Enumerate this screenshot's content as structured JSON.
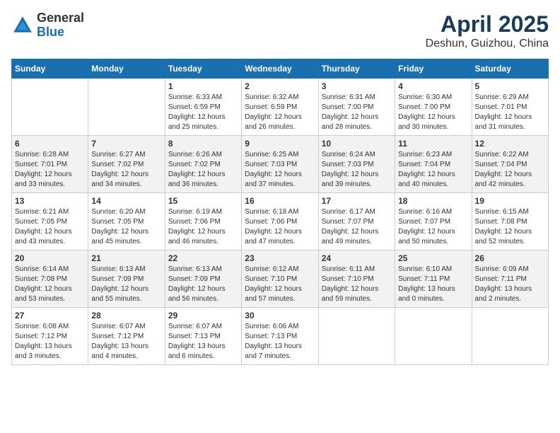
{
  "header": {
    "logo_general": "General",
    "logo_blue": "Blue",
    "month_title": "April 2025",
    "location": "Deshun, Guizhou, China"
  },
  "calendar": {
    "days_of_week": [
      "Sunday",
      "Monday",
      "Tuesday",
      "Wednesday",
      "Thursday",
      "Friday",
      "Saturday"
    ],
    "weeks": [
      [
        {
          "day": "",
          "info": ""
        },
        {
          "day": "",
          "info": ""
        },
        {
          "day": "1",
          "info": "Sunrise: 6:33 AM\nSunset: 6:59 PM\nDaylight: 12 hours and 25 minutes."
        },
        {
          "day": "2",
          "info": "Sunrise: 6:32 AM\nSunset: 6:59 PM\nDaylight: 12 hours and 26 minutes."
        },
        {
          "day": "3",
          "info": "Sunrise: 6:31 AM\nSunset: 7:00 PM\nDaylight: 12 hours and 28 minutes."
        },
        {
          "day": "4",
          "info": "Sunrise: 6:30 AM\nSunset: 7:00 PM\nDaylight: 12 hours and 30 minutes."
        },
        {
          "day": "5",
          "info": "Sunrise: 6:29 AM\nSunset: 7:01 PM\nDaylight: 12 hours and 31 minutes."
        }
      ],
      [
        {
          "day": "6",
          "info": "Sunrise: 6:28 AM\nSunset: 7:01 PM\nDaylight: 12 hours and 33 minutes."
        },
        {
          "day": "7",
          "info": "Sunrise: 6:27 AM\nSunset: 7:02 PM\nDaylight: 12 hours and 34 minutes."
        },
        {
          "day": "8",
          "info": "Sunrise: 6:26 AM\nSunset: 7:02 PM\nDaylight: 12 hours and 36 minutes."
        },
        {
          "day": "9",
          "info": "Sunrise: 6:25 AM\nSunset: 7:03 PM\nDaylight: 12 hours and 37 minutes."
        },
        {
          "day": "10",
          "info": "Sunrise: 6:24 AM\nSunset: 7:03 PM\nDaylight: 12 hours and 39 minutes."
        },
        {
          "day": "11",
          "info": "Sunrise: 6:23 AM\nSunset: 7:04 PM\nDaylight: 12 hours and 40 minutes."
        },
        {
          "day": "12",
          "info": "Sunrise: 6:22 AM\nSunset: 7:04 PM\nDaylight: 12 hours and 42 minutes."
        }
      ],
      [
        {
          "day": "13",
          "info": "Sunrise: 6:21 AM\nSunset: 7:05 PM\nDaylight: 12 hours and 43 minutes."
        },
        {
          "day": "14",
          "info": "Sunrise: 6:20 AM\nSunset: 7:05 PM\nDaylight: 12 hours and 45 minutes."
        },
        {
          "day": "15",
          "info": "Sunrise: 6:19 AM\nSunset: 7:06 PM\nDaylight: 12 hours and 46 minutes."
        },
        {
          "day": "16",
          "info": "Sunrise: 6:18 AM\nSunset: 7:06 PM\nDaylight: 12 hours and 47 minutes."
        },
        {
          "day": "17",
          "info": "Sunrise: 6:17 AM\nSunset: 7:07 PM\nDaylight: 12 hours and 49 minutes."
        },
        {
          "day": "18",
          "info": "Sunrise: 6:16 AM\nSunset: 7:07 PM\nDaylight: 12 hours and 50 minutes."
        },
        {
          "day": "19",
          "info": "Sunrise: 6:15 AM\nSunset: 7:08 PM\nDaylight: 12 hours and 52 minutes."
        }
      ],
      [
        {
          "day": "20",
          "info": "Sunrise: 6:14 AM\nSunset: 7:08 PM\nDaylight: 12 hours and 53 minutes."
        },
        {
          "day": "21",
          "info": "Sunrise: 6:13 AM\nSunset: 7:09 PM\nDaylight: 12 hours and 55 minutes."
        },
        {
          "day": "22",
          "info": "Sunrise: 6:13 AM\nSunset: 7:09 PM\nDaylight: 12 hours and 56 minutes."
        },
        {
          "day": "23",
          "info": "Sunrise: 6:12 AM\nSunset: 7:10 PM\nDaylight: 12 hours and 57 minutes."
        },
        {
          "day": "24",
          "info": "Sunrise: 6:11 AM\nSunset: 7:10 PM\nDaylight: 12 hours and 59 minutes."
        },
        {
          "day": "25",
          "info": "Sunrise: 6:10 AM\nSunset: 7:11 PM\nDaylight: 13 hours and 0 minutes."
        },
        {
          "day": "26",
          "info": "Sunrise: 6:09 AM\nSunset: 7:11 PM\nDaylight: 13 hours and 2 minutes."
        }
      ],
      [
        {
          "day": "27",
          "info": "Sunrise: 6:08 AM\nSunset: 7:12 PM\nDaylight: 13 hours and 3 minutes."
        },
        {
          "day": "28",
          "info": "Sunrise: 6:07 AM\nSunset: 7:12 PM\nDaylight: 13 hours and 4 minutes."
        },
        {
          "day": "29",
          "info": "Sunrise: 6:07 AM\nSunset: 7:13 PM\nDaylight: 13 hours and 6 minutes."
        },
        {
          "day": "30",
          "info": "Sunrise: 6:06 AM\nSunset: 7:13 PM\nDaylight: 13 hours and 7 minutes."
        },
        {
          "day": "",
          "info": ""
        },
        {
          "day": "",
          "info": ""
        },
        {
          "day": "",
          "info": ""
        }
      ]
    ]
  }
}
